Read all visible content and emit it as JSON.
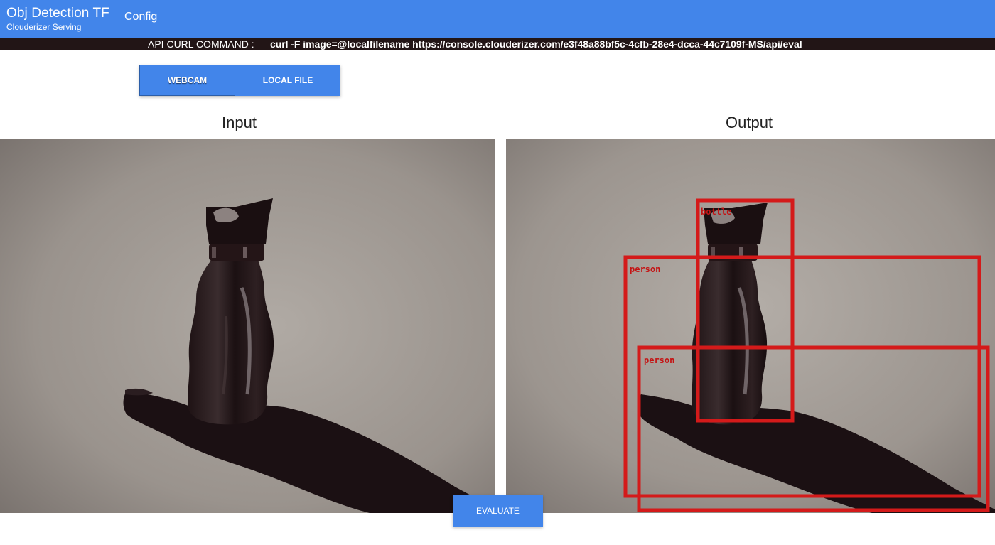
{
  "header": {
    "title": "Obj Detection TF",
    "subtitle": "Clouderizer Serving",
    "nav": {
      "config": "Config"
    }
  },
  "api": {
    "label": "API CURL COMMAND :",
    "command": "curl -F image=@localfilename https://console.clouderizer.com/e3f48a88bf5c-4cfb-28e4-dcca-44c7109f-MS/api/eval"
  },
  "source": {
    "webcam": "WEBCAM",
    "local_file": "LOCAL FILE",
    "selected": "WEBCAM"
  },
  "panels": {
    "input_title": "Input",
    "output_title": "Output"
  },
  "detections": [
    {
      "label": "bottle"
    },
    {
      "label": "person"
    },
    {
      "label": "person"
    }
  ],
  "actions": {
    "evaluate": "EVALUATE"
  },
  "colors": {
    "primary": "#4285ea",
    "curl_bar": "#221516",
    "detection_box": "#d41a1a"
  }
}
